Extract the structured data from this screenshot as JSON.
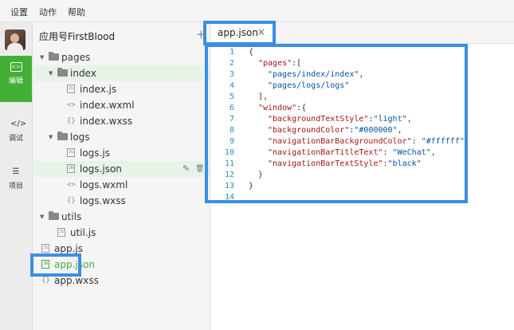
{
  "menubar": {
    "items": [
      "设置",
      "动作",
      "帮助"
    ]
  },
  "leftbar": {
    "items": [
      {
        "label": "编辑",
        "icon": "code-icon",
        "glyph": "<>"
      },
      {
        "label": "调试",
        "icon": "debug-icon",
        "glyph": "</>"
      },
      {
        "label": "项目",
        "icon": "menu-icon",
        "glyph": "☰"
      }
    ]
  },
  "tree": {
    "project_title": "应用号FirstBlood",
    "add_symbol": "+",
    "items": [
      {
        "name": "pages",
        "kind": "folder"
      },
      {
        "name": "index",
        "kind": "folder"
      },
      {
        "name": "index.js",
        "kind": "file",
        "badge": "JS"
      },
      {
        "name": "index.wxml",
        "kind": "file",
        "badge": "<>"
      },
      {
        "name": "index.wxss",
        "kind": "file",
        "badge": "{}"
      },
      {
        "name": "logs",
        "kind": "folder"
      },
      {
        "name": "logs.js",
        "kind": "file",
        "badge": "JS"
      },
      {
        "name": "logs.json",
        "kind": "file",
        "badge": "JN"
      },
      {
        "name": "logs.wxml",
        "kind": "file",
        "badge": "<>"
      },
      {
        "name": "logs.wxss",
        "kind": "file",
        "badge": "{}"
      },
      {
        "name": "utils",
        "kind": "folder"
      },
      {
        "name": "util.js",
        "kind": "file",
        "badge": "JS"
      },
      {
        "name": "app.js",
        "kind": "file",
        "badge": "JS"
      },
      {
        "name": "app.json",
        "kind": "file",
        "badge": "JN"
      },
      {
        "name": "app.wxss",
        "kind": "file",
        "badge": "{}"
      }
    ],
    "row_actions": {
      "edit": "✎",
      "delete": "🗑"
    }
  },
  "editor": {
    "tab": {
      "label": "app.json",
      "close": "×"
    },
    "line_numbers": [
      "1",
      "2",
      "3",
      "4",
      "5",
      "6",
      "7",
      "8",
      "9",
      "10",
      "11",
      "12",
      "13",
      "14"
    ],
    "lines": [
      {
        "text": "{"
      },
      {
        "key": "\"pages\"",
        "rest": ":["
      },
      {
        "str": "\"pages/index/index\"",
        "rest": ","
      },
      {
        "str": "\"pages/logs/logs\""
      },
      {
        "text": "],"
      },
      {
        "key": "\"window\"",
        "rest": ":{"
      },
      {
        "key": "\"backgroundTextStyle\"",
        "rest": ":",
        "str": "\"light\"",
        "tail": ","
      },
      {
        "key": "\"backgroundColor\"",
        "rest": ":",
        "str": "\"#000000\"",
        "tail": ","
      },
      {
        "key": "\"navigationBarBackgroundColor\"",
        "rest": ": ",
        "str": "\"#ffffff\"",
        "tail": ","
      },
      {
        "key": "\"navigationBarTitleText\"",
        "rest": ": ",
        "str": "\"WeChat\"",
        "tail": ","
      },
      {
        "key": "\"navigationBarTextStyle\"",
        "rest": ":",
        "str": "\"black\""
      },
      {
        "text": "}"
      },
      {
        "text": "}"
      },
      {
        "text": ""
      }
    ]
  },
  "colors": {
    "accent": "#41b035",
    "highlight": "#3a8ee6",
    "key": "#a31515",
    "string": "#0451a5",
    "line_number": "#2b91af"
  }
}
